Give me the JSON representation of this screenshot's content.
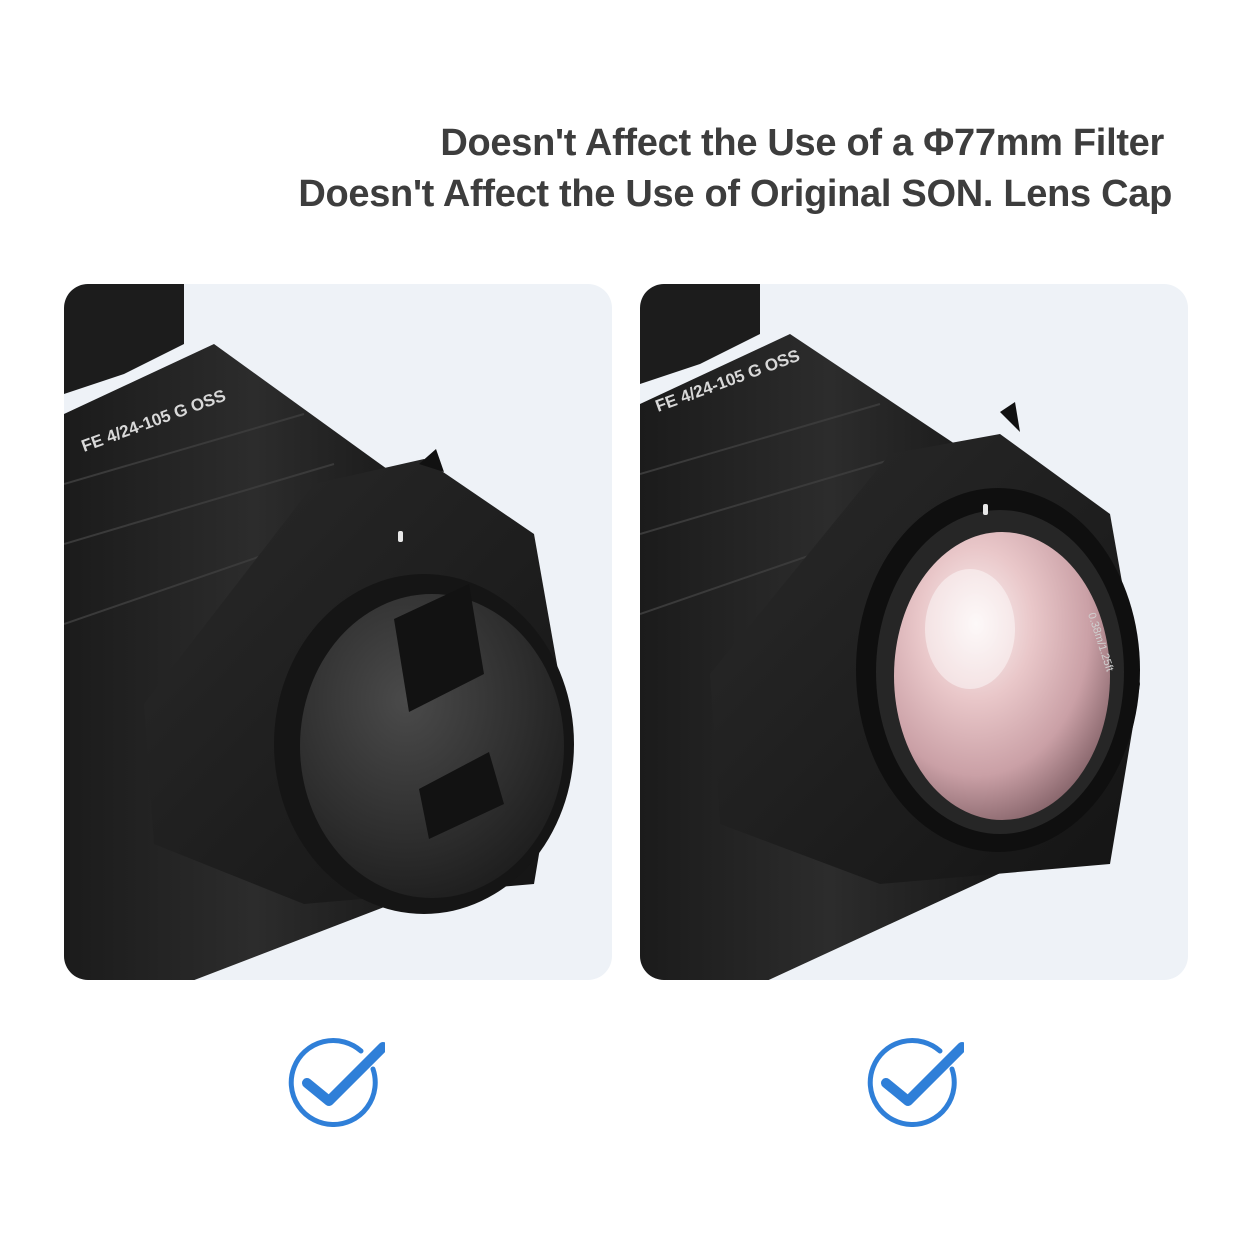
{
  "headline": {
    "line1": "Doesn't Affect the Use of a Φ77mm Filter",
    "line2": "Doesn't Affect the Use of Original SON. Lens Cap"
  },
  "panels": [
    {
      "image": "camera-lens-with-hood-and-lens-cap-photo",
      "lens_text": "FE 4/24-105 G OSS",
      "status_icon": "blue-checkmark-circle-icon"
    },
    {
      "image": "camera-lens-with-hood-and-filter-photo",
      "lens_text": "FE 4/24-105 G OSS",
      "filter_text": "0.38m/1.25ft",
      "status_icon": "blue-checkmark-circle-icon"
    }
  ],
  "colors": {
    "headline": "#3d3d3d",
    "panel_background": "#eef2f7",
    "check_blue": "#2f7fd8"
  }
}
